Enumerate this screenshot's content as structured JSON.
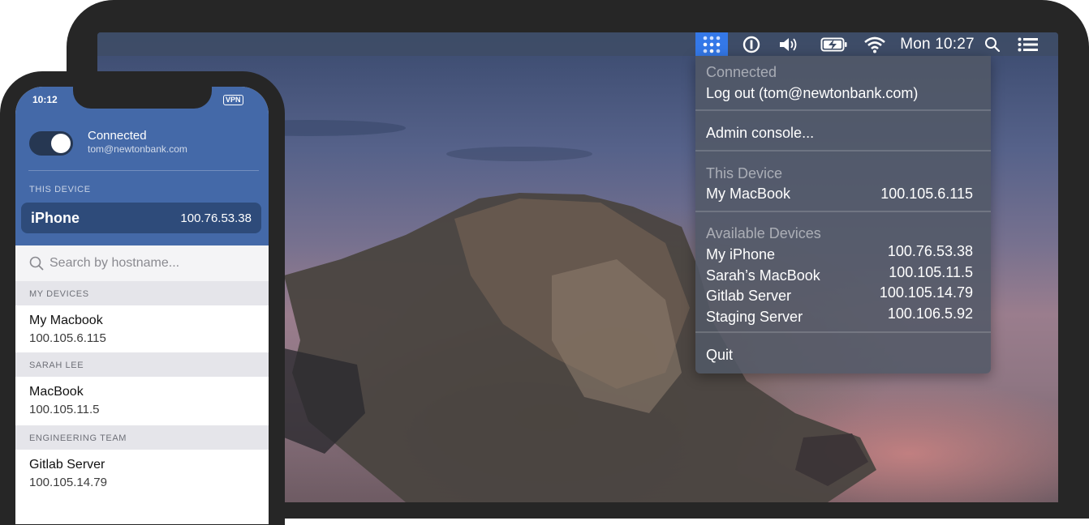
{
  "mac": {
    "menubar": {
      "clock": "Mon 10:27",
      "icons": [
        "tailscale-icon",
        "password-manager-icon",
        "volume-icon",
        "battery-charging-icon",
        "wifi-icon",
        "search-icon",
        "list-icon"
      ]
    },
    "menu": {
      "status": "Connected",
      "logout": "Log out (tom@newtonbank.com)",
      "admin": "Admin console...",
      "this_device_header": "This Device",
      "this_device": {
        "name": "My MacBook",
        "ip": "100.105.6.115"
      },
      "available_header": "Available Devices",
      "available": [
        {
          "name": "My iPhone",
          "ip": "100.76.53.38"
        },
        {
          "name": "Sarah’s MacBook",
          "ip": "100.105.11.5"
        },
        {
          "name": "Gitlab Server",
          "ip": "100.105.14.79"
        },
        {
          "name": "Staging Server",
          "ip": "100.106.5.92"
        }
      ],
      "quit": "Quit"
    }
  },
  "phone": {
    "status_time": "10:12",
    "vpn_badge": "VPN",
    "status": "Connected",
    "email": "tom@newtonbank.com",
    "toggle_on": true,
    "this_device_header": "THIS DEVICE",
    "this_device": {
      "name": "iPhone",
      "ip": "100.76.53.38"
    },
    "search_placeholder": "Search by hostname...",
    "sections": [
      {
        "title": "MY DEVICES",
        "items": [
          {
            "name": "My Macbook",
            "ip": "100.105.6.115"
          }
        ]
      },
      {
        "title": "SARAH LEE",
        "items": [
          {
            "name": "MacBook",
            "ip": "100.105.11.5"
          }
        ]
      },
      {
        "title": "ENGINEERING TEAM",
        "items": [
          {
            "name": "Gitlab Server",
            "ip": "100.105.14.79"
          }
        ]
      }
    ]
  }
}
